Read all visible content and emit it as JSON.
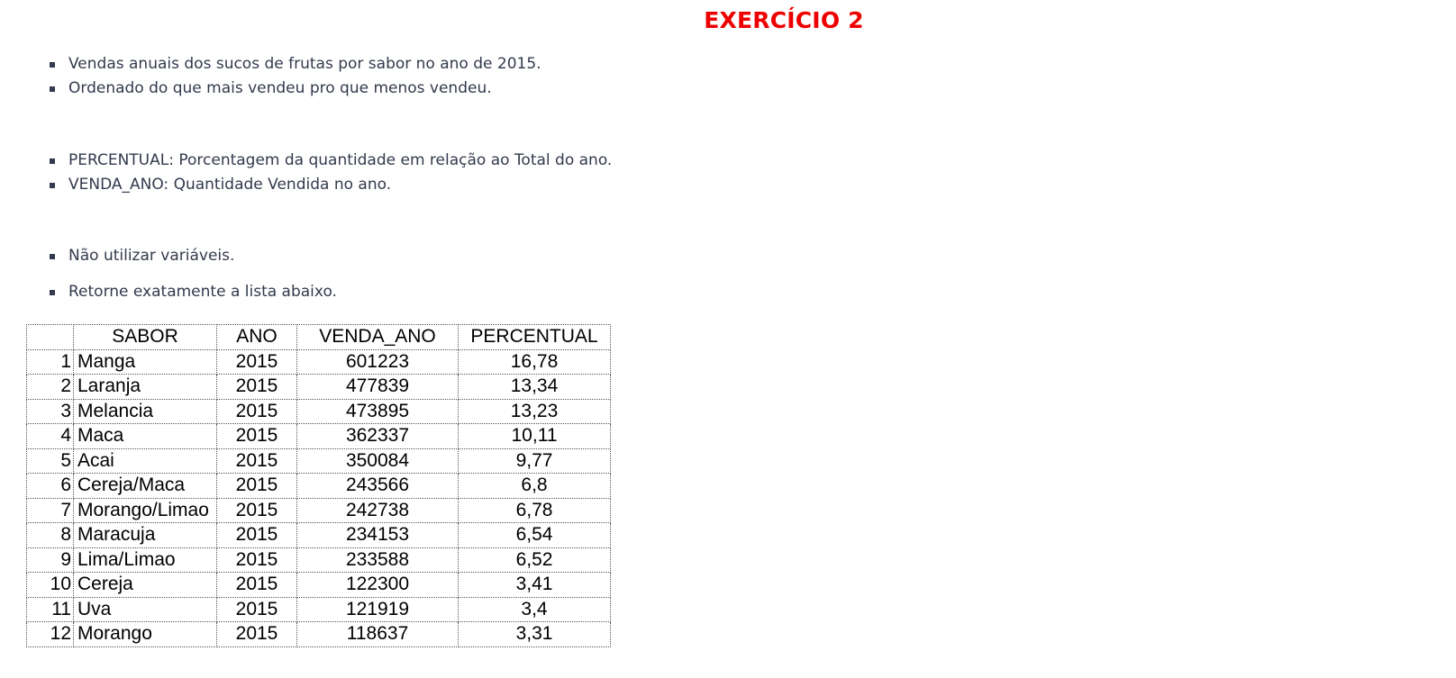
{
  "title": "EXERCÍCIO 2",
  "bullets_group1": [
    "Vendas anuais dos sucos de frutas por sabor no ano de 2015.",
    "Ordenado do que mais vendeu pro que menos vendeu."
  ],
  "bullets_group2": [
    "PERCENTUAL: Porcentagem da quantidade em relação ao Total do ano.",
    "VENDA_ANO: Quantidade Vendida no ano."
  ],
  "bullets_group3": [
    "Não utilizar variáveis."
  ],
  "bullets_group4": [
    "Retorne exatamente a lista abaixo."
  ],
  "table": {
    "headers": [
      "",
      "SABOR",
      "ANO",
      "VENDA_ANO",
      "PERCENTUAL"
    ],
    "rows": [
      [
        "1",
        "Manga",
        "2015",
        "601223",
        "16,78"
      ],
      [
        "2",
        "Laranja",
        "2015",
        "477839",
        "13,34"
      ],
      [
        "3",
        "Melancia",
        "2015",
        "473895",
        "13,23"
      ],
      [
        "4",
        "Maca",
        "2015",
        "362337",
        "10,11"
      ],
      [
        "5",
        "Acai",
        "2015",
        "350084",
        "9,77"
      ],
      [
        "6",
        "Cereja/Maca",
        "2015",
        "243566",
        "6,8"
      ],
      [
        "7",
        "Morango/Limao",
        "2015",
        "242738",
        "6,78"
      ],
      [
        "8",
        "Maracuja",
        "2015",
        "234153",
        "6,54"
      ],
      [
        "9",
        "Lima/Limao",
        "2015",
        "233588",
        "6,52"
      ],
      [
        "10",
        "Cereja",
        "2015",
        "122300",
        "3,41"
      ],
      [
        "11",
        "Uva",
        "2015",
        "121919",
        "3,4"
      ],
      [
        "12",
        "Morango",
        "2015",
        "118637",
        "3,31"
      ]
    ]
  },
  "colors": {
    "title": "#ee0000",
    "text": "#333a4d",
    "table_text": "#000000"
  }
}
